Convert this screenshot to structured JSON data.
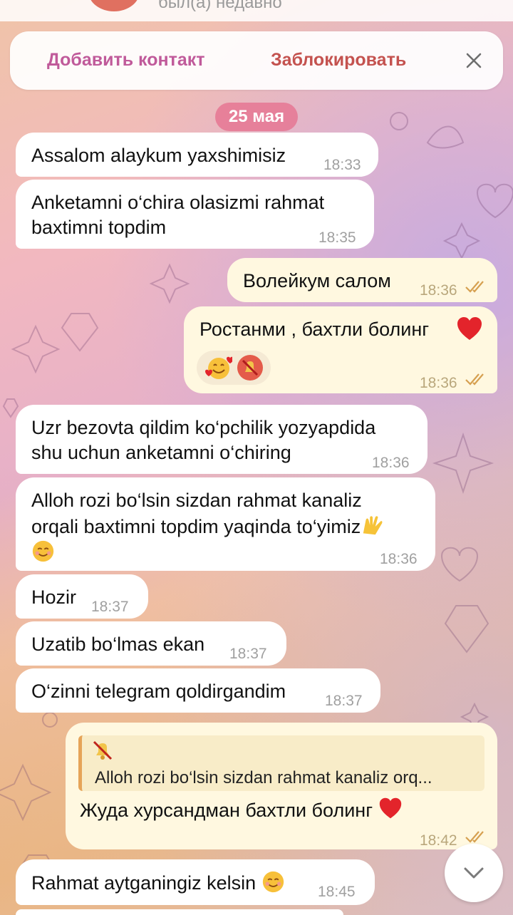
{
  "header": {
    "status": "был(а) недавно"
  },
  "action_bar": {
    "add_contact": "Добавить контакт",
    "block": "Заблокировать"
  },
  "date_label": "25 мая",
  "messages": [
    {
      "text": "Assalom alaykum yaxshimisiz",
      "time": "18:33"
    },
    {
      "text_lines": [
        "Anketamni o‘chira olasizmi rahmat",
        "baxtimni topdim"
      ],
      "time": "18:35"
    },
    {
      "text": "Волейкум салом",
      "time": "18:36"
    },
    {
      "text": "Ростанми , бахтли болинг",
      "time": "18:36"
    },
    {
      "text_lines": [
        "Uzr bezovta qildim ko‘pchilik yozyapdida",
        "shu uchun anketamni o‘chiring"
      ],
      "time": "18:36"
    },
    {
      "text_lines": [
        "Alloh rozi bo‘lsin sizdan rahmat kanaliz",
        "orqali baxtimni topdim yaqinda to‘yimiz"
      ],
      "time": "18:36"
    },
    {
      "text": "Hozir",
      "time": "18:37"
    },
    {
      "text": "Uzatib bo‘lmas ekan",
      "time": "18:37"
    },
    {
      "text": "O‘zinni telegram qoldirgandim",
      "time": "18:37"
    },
    {
      "reply_text": "Alloh rozi bo‘lsin sizdan rahmat kanaliz orq...",
      "text": "Жуда хурсандман бахтли болинг",
      "time": "18:42"
    },
    {
      "text": "Rahmat aytganingiz kelsin",
      "time": "18:45"
    }
  ],
  "icons": {
    "close": "close-icon",
    "read_checks": "double-check-icon",
    "heart": "red-heart-emoji",
    "smiling_face": "smiling-face-emoji",
    "hearts_face": "smiling-face-with-hearts-emoji",
    "muted_bell": "muted-bell-emoji",
    "raised_hands": "raising-hands-emoji",
    "scroll_down": "chevron-down-icon"
  },
  "colors": {
    "add_contact": "#c05a9a",
    "block": "#c4524f",
    "incoming_bubble": "#ffffff",
    "outgoing_bubble": "#fff8e0",
    "date_pill": "#e66e8c"
  }
}
